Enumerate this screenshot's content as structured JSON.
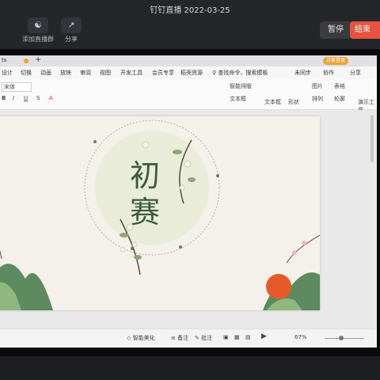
{
  "live": {
    "title": "钉钉直播 2022-03-25",
    "tools": [
      {
        "label": "添加直播群",
        "icon": "group-add-icon"
      },
      {
        "label": "分享",
        "icon": "share-icon"
      }
    ],
    "pause_label": "暂停",
    "end_label": "结束"
  },
  "app": {
    "tab_label": "ts",
    "member_badge": "访客登录",
    "menu": [
      "设计",
      "切换",
      "动画",
      "放映",
      "审阅",
      "视图",
      "开发工具",
      "会员专享",
      "稻壳资源"
    ],
    "search_placeholder": "查找命令、搜索模板",
    "top_actions": [
      "未同步",
      "协作",
      "分享"
    ],
    "ribbon": {
      "font_name": "宋体",
      "items": [
        "文本框",
        "形状",
        "图片",
        "排列",
        "演示工具"
      ],
      "small": [
        "智能排版",
        "文本框",
        "表格",
        "轮廓"
      ]
    },
    "slide": {
      "title_line1": "初",
      "title_line2": "赛"
    },
    "status": {
      "beautify": "智能美化",
      "notes": "备注",
      "comment": "批注",
      "zoom": "67%"
    }
  },
  "colors": {
    "end_button": "#e6533f",
    "member_badge": "#e8a53a",
    "slide_bg": "#f4f1ea",
    "title_text": "#3d5a3a"
  }
}
